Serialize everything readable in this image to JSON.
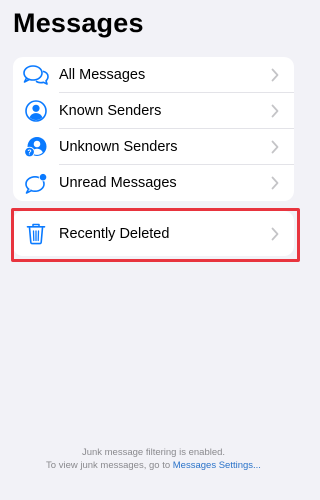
{
  "header": {
    "title": "Messages"
  },
  "filters": {
    "items": [
      {
        "label": "All Messages",
        "icon": "chat-bubbles-icon"
      },
      {
        "label": "Known Senders",
        "icon": "person-circle-icon"
      },
      {
        "label": "Unknown Senders",
        "icon": "person-question-icon"
      },
      {
        "label": "Unread Messages",
        "icon": "unread-bubble-icon"
      }
    ]
  },
  "deleted": {
    "label": "Recently Deleted",
    "icon": "trash-icon"
  },
  "footer": {
    "line1": "Junk message filtering is enabled.",
    "line2_prefix": "To view junk messages, go to ",
    "line2_link": "Messages Settings..."
  },
  "colors": {
    "accent": "#0a7aff",
    "highlight": "#e8343e",
    "background": "#f2f2f7",
    "chevron": "#c4c4c7"
  }
}
